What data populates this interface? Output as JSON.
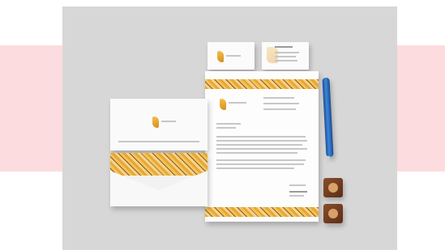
{
  "image": {
    "kind": "stationery-mockup-photo",
    "background_color": "#d7d7d7",
    "side_band_color": "#fcdcde",
    "pattern_colors": [
      "#e8a635",
      "#f6d48a",
      "#8a5a2b",
      "#f3c45a"
    ],
    "pen_color": "#2f74c8",
    "clip_color": "#7a4022"
  }
}
